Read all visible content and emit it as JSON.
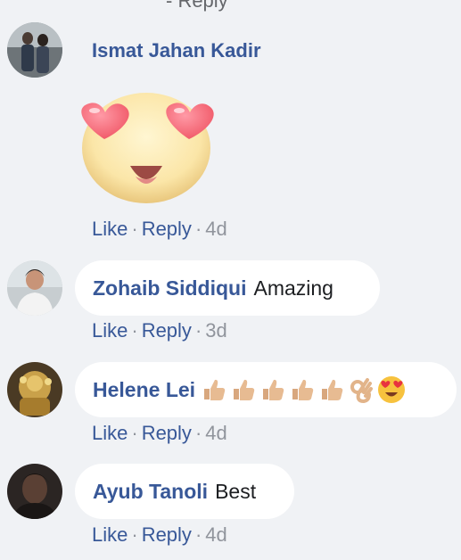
{
  "top_partial_text": "- Reply",
  "colors": {
    "background": "#f0f2f5",
    "name": "#385898",
    "link": "#385898",
    "muted": "#90949c",
    "bubble": "#ffffff"
  },
  "comments": [
    {
      "author": "Ismat Jahan Kadir",
      "text": "",
      "attachment": "heart-eyes-emoji-sticker",
      "actions": {
        "like": "Like",
        "reply": "Reply",
        "time": "4d"
      }
    },
    {
      "author": "Zohaib Siddiqui",
      "text": "Amazing",
      "actions": {
        "like": "Like",
        "reply": "Reply",
        "time": "3d"
      }
    },
    {
      "author": "Helene Lei",
      "text": "",
      "emojis": [
        "thumbs-up",
        "thumbs-up",
        "thumbs-up",
        "thumbs-up",
        "thumbs-up",
        "ok-hand",
        "heart-eyes"
      ],
      "actions": {
        "like": "Like",
        "reply": "Reply",
        "time": "4d"
      }
    },
    {
      "author": "Ayub Tanoli",
      "text": "Best",
      "actions": {
        "like": "Like",
        "reply": "Reply",
        "time": "4d"
      }
    }
  ]
}
